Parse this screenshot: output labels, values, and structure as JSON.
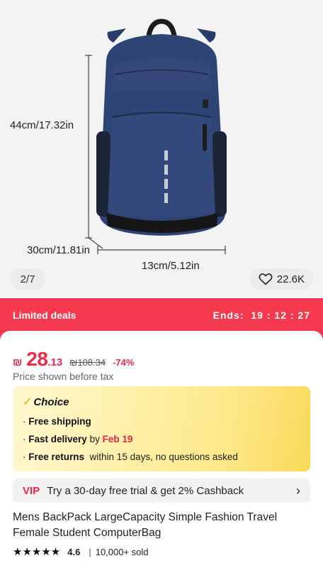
{
  "gallery": {
    "dimensions": {
      "height": "44cm/17.32in",
      "depth": "30cm/11.81in",
      "width": "13cm/5.12in"
    },
    "counter": "2/7",
    "likes": "22.6K"
  },
  "deals": {
    "label": "Limited deals",
    "ends_label": "Ends:",
    "timer": "19 : 12 : 27"
  },
  "price": {
    "currency": "₪",
    "main": "28",
    "decimal": ".13",
    "original": "₪108.34",
    "discount": "-74%",
    "note": "Price shown before tax"
  },
  "choice": {
    "title": "Choice",
    "free_shipping": "Free shipping",
    "fast_delivery": "Fast delivery",
    "by": "by",
    "delivery_date": "Feb 19",
    "free_returns": "Free returns",
    "returns_detail": "within 15 days, no questions asked"
  },
  "vip": {
    "tag": "VIP",
    "text": "Try a 30-day free trial & get 2% Cashback"
  },
  "product": {
    "title": "Mens BackPack LargeCapacity Simple Fashion Travel Female Student ComputerBag",
    "stars": "★★★★★",
    "rating": "4.6",
    "sold": "10,000+ sold"
  },
  "colors": {
    "accent": "#f53a50",
    "price": "#f0294a",
    "bag": "#2c3f6f"
  }
}
